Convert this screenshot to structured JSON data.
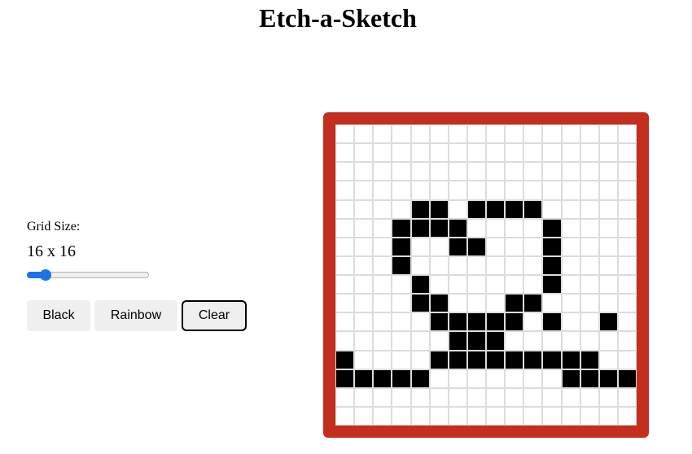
{
  "page": {
    "title": "Etch-a-Sketch"
  },
  "controls": {
    "grid_size_label": "Grid Size:",
    "grid_size_value": "16 x 16",
    "slider_value": 16,
    "buttons": {
      "black": "Black",
      "rainbow": "Rainbow",
      "clear": "Clear"
    }
  },
  "colors": {
    "frame": "#c42e1e",
    "ink": "#000000",
    "accent": "#1a73e8"
  },
  "grid": {
    "size": 16,
    "rows": [
      "................",
      "................",
      "................",
      "................",
      "....XX.XXXX.....",
      "...XXXX....X....",
      "...X..XX...X....",
      "...X.......X....",
      "....X......X....",
      "....XX...XX.....",
      ".....XXXXX.X..X.",
      "......XXX.......",
      "X....XXXXXXXXX..",
      "XXXXX.......XXXXX",
      "................",
      "................"
    ]
  }
}
